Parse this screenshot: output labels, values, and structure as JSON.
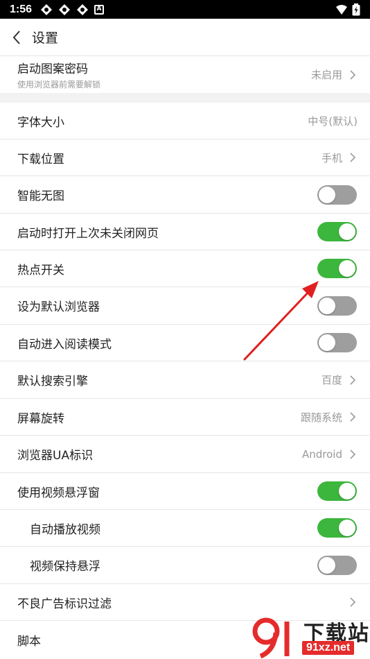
{
  "status_bar": {
    "time": "1:56",
    "badge": "A"
  },
  "header": {
    "title": "设置"
  },
  "items": [
    {
      "label": "启动图案密码",
      "sub": "使用浏览器前需要解锁",
      "value": "未启用",
      "type": "chevron"
    },
    {
      "label": "字体大小",
      "value": "中号(默认)",
      "type": "value"
    },
    {
      "label": "下载位置",
      "value": "手机",
      "type": "chevron"
    },
    {
      "label": "智能无图",
      "type": "toggle",
      "on": false
    },
    {
      "label": "启动时打开上次未关闭网页",
      "type": "toggle",
      "on": true
    },
    {
      "label": "热点开关",
      "type": "toggle",
      "on": true
    },
    {
      "label": "设为默认浏览器",
      "type": "toggle",
      "on": false
    },
    {
      "label": "自动进入阅读模式",
      "type": "toggle",
      "on": false
    },
    {
      "label": "默认搜索引擎",
      "value": "百度",
      "type": "chevron"
    },
    {
      "label": "屏幕旋转",
      "value": "跟随系统",
      "type": "chevron"
    },
    {
      "label": "浏览器UA标识",
      "value": "Android",
      "type": "chevron"
    },
    {
      "label": "使用视频悬浮窗",
      "type": "toggle",
      "on": true
    },
    {
      "label": "自动播放视频",
      "type": "toggle",
      "on": true
    },
    {
      "label": "视频保持悬浮",
      "type": "toggle",
      "on": false
    },
    {
      "label": "不良广告标识过滤",
      "type": "chevron"
    },
    {
      "label": "脚本",
      "type": "plain"
    }
  ],
  "watermark": {
    "title": "下载站",
    "domain": "91xz.net"
  },
  "colors": {
    "toggle_on": "#3cb63c",
    "toggle_off": "#9e9e9e",
    "arrow": "#e02020"
  }
}
